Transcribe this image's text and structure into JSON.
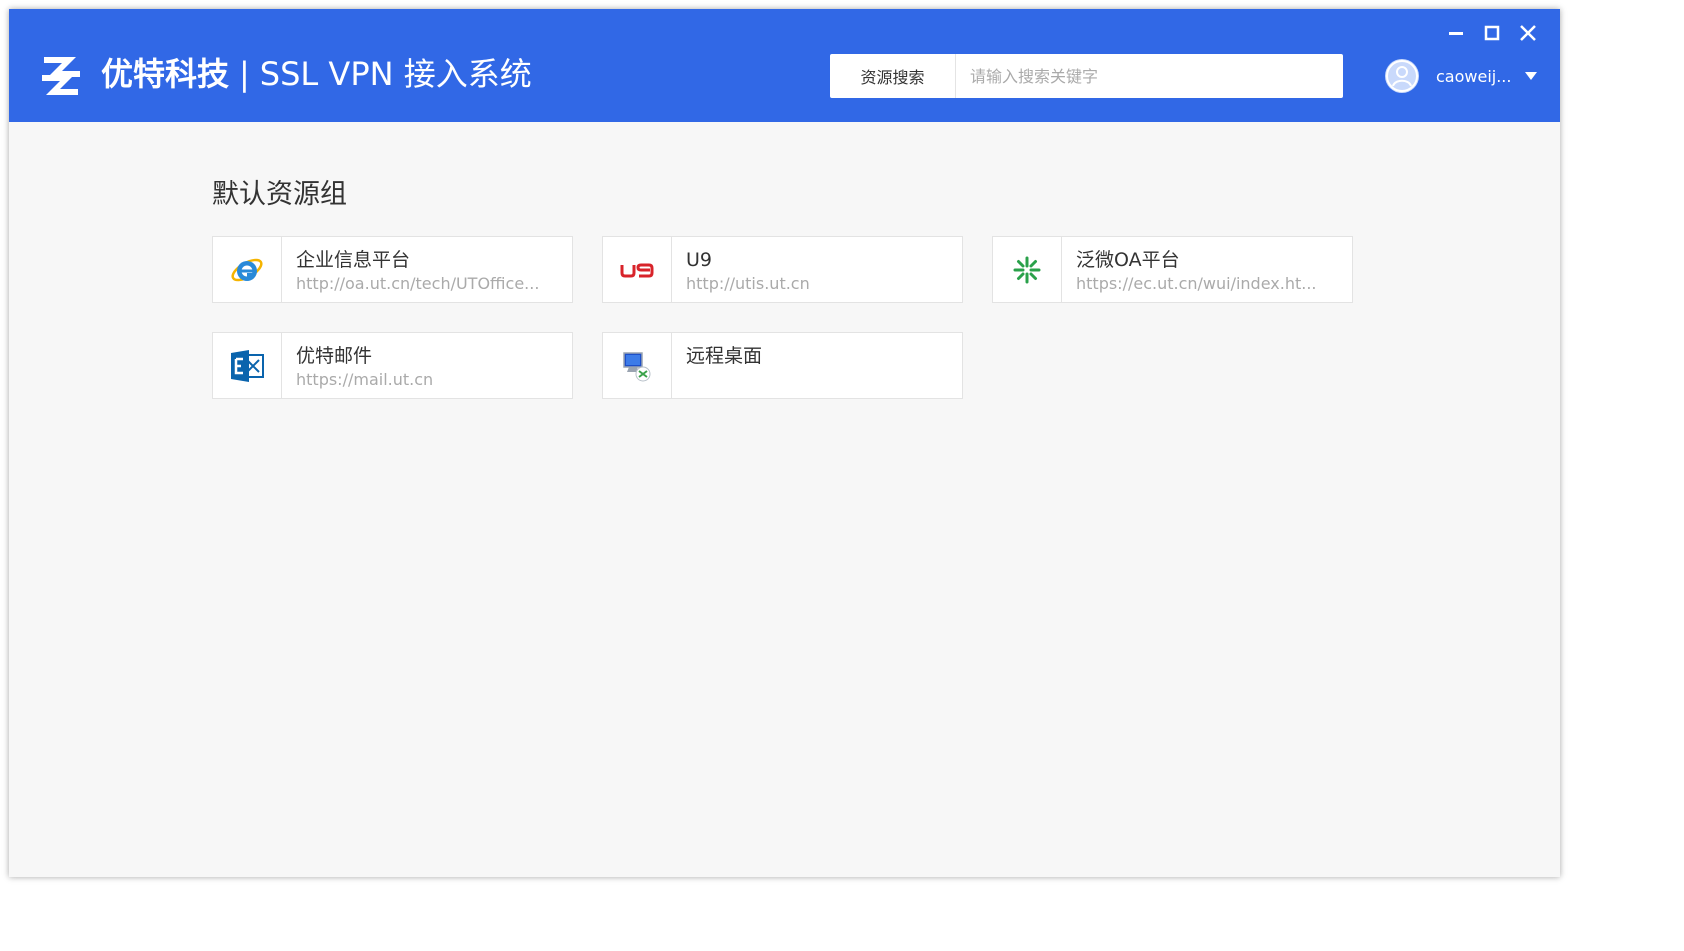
{
  "header": {
    "company": "优特科技",
    "separator": "|",
    "system_name": "SSL VPN 接入系统",
    "bg_color": "#3168e6"
  },
  "search": {
    "type_label": "资源搜索",
    "placeholder": "请输入搜索关键字",
    "value": ""
  },
  "user": {
    "name": "caoweij...",
    "avatar_icon": "user-avatar-icon"
  },
  "window_controls": {
    "minimize_icon": "minimize-icon",
    "maximize_icon": "maximize-icon",
    "close_icon": "close-icon"
  },
  "group": {
    "title": "默认资源组",
    "resources": [
      {
        "name": "企业信息平台",
        "url": "http://oa.ut.cn/tech/UTOffice...",
        "icon": "internet-explorer-icon"
      },
      {
        "name": "U9",
        "url": "http://utis.ut.cn",
        "icon": "u9-logo-icon"
      },
      {
        "name": "泛微OA平台",
        "url": "https://ec.ut.cn/wui/index.ht...",
        "icon": "weaver-oa-icon"
      },
      {
        "name": "优特邮件",
        "url": "https://mail.ut.cn",
        "icon": "exchange-mail-icon"
      },
      {
        "name": "远程桌面",
        "url": "",
        "icon": "remote-desktop-icon"
      }
    ]
  }
}
